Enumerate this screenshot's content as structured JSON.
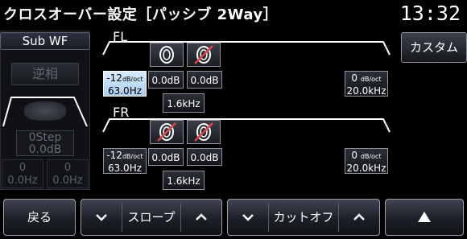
{
  "header": {
    "title": "クロスオーバー設定［パッシブ 2Way］",
    "clock": "13:32"
  },
  "subwf": {
    "label": "Sub WF",
    "reverse_label": "逆相",
    "step_line1": "0Step",
    "step_line2": "0.0dB",
    "left_val_line1": "0",
    "left_val_line2": "0.0Hz",
    "right_val_line1": "0",
    "right_val_line2": "0.0Hz",
    "unit": "dB/oct"
  },
  "fl": {
    "label": "FL",
    "hpf_slope": "-12",
    "hpf_freq": "63.0Hz",
    "level_1": "0.0dB",
    "level_2": "0.0dB",
    "crossover_freq": "1.6kHz",
    "lpf_slope": "0",
    "lpf_freq": "20.0kHz",
    "unit_db": "dB",
    "unit_oct": "oct"
  },
  "fr": {
    "label": "FR",
    "hpf_slope": "-12",
    "hpf_freq": "63.0Hz",
    "level_1": "0.0dB",
    "level_2": "0.0dB",
    "crossover_freq": "1.6kHz",
    "lpf_slope": "0",
    "lpf_freq": "20.0kHz",
    "unit_db": "dB",
    "unit_oct": "oct"
  },
  "custom_button": "カスタム",
  "bottom": {
    "back": "戻る",
    "slope": "スロープ",
    "cutoff": "カットオフ"
  },
  "colors": {
    "selected_box": "#cfe6ff",
    "muted_icon": "#e04646",
    "frame_border": "#9aa0ab"
  },
  "icons": {
    "speaker": "speaker-icon",
    "speaker_muted": "speaker-muted-icon",
    "chevron_down": "chevron-down-icon",
    "chevron_up": "chevron-up-icon",
    "triangle_up": "triangle-up-icon"
  }
}
